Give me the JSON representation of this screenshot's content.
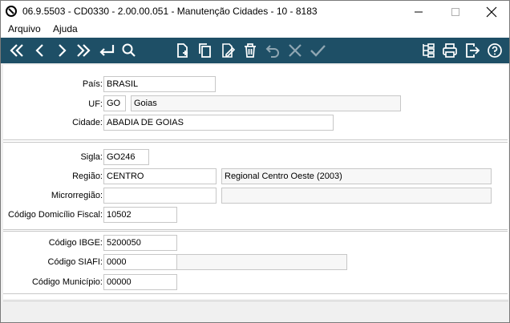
{
  "window": {
    "title": "06.9.5503 - CD0330 - 2.00.00.051 - Manutenção Cidades - 10 - 8183"
  },
  "menu": {
    "items": [
      "Arquivo",
      "Ajuda"
    ]
  },
  "toolbar": {
    "color": "#1e4f66",
    "buttons": [
      "first-icon",
      "previous-icon",
      "next-icon",
      "last-icon",
      "goto-icon",
      "search-icon",
      "new-icon",
      "copy-icon",
      "edit-icon",
      "delete-icon",
      "undo-icon",
      "cancel-icon",
      "confirm-icon",
      "tree-icon",
      "print-icon",
      "exit-icon",
      "help-icon"
    ]
  },
  "form": {
    "pais": {
      "label": "País:",
      "value": "BRASIL"
    },
    "uf": {
      "label": "UF:",
      "code": "GO",
      "name": "Goias"
    },
    "cidade": {
      "label": "Cidade:",
      "value": "ABADIA DE GOIAS"
    },
    "sigla": {
      "label": "Sigla:",
      "value": "GO246"
    },
    "regiao": {
      "label": "Região:",
      "code": "CENTRO",
      "description": "Regional Centro Oeste (2003)"
    },
    "microrregiao": {
      "label": "Microrregião:",
      "code": "",
      "description": ""
    },
    "codigo_domicilio_fiscal": {
      "label": "Código Domicílio Fiscal:",
      "value": "10502"
    },
    "codigo_ibge": {
      "label": "Código IBGE:",
      "value": "5200050"
    },
    "codigo_siafi": {
      "label": "Código SIAFI:",
      "value": "0000",
      "extra": ""
    },
    "codigo_municipio": {
      "label": "Código Município:",
      "value": "00000"
    }
  }
}
